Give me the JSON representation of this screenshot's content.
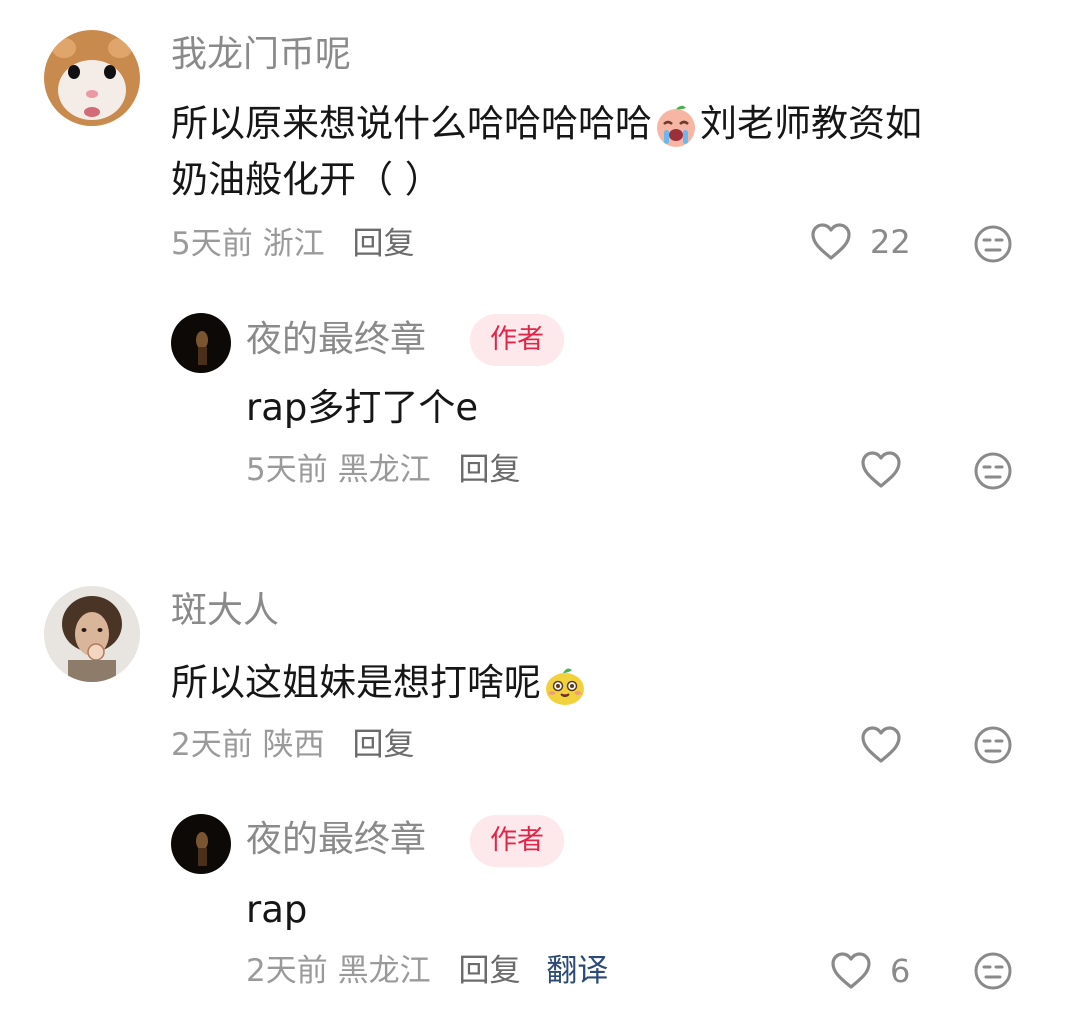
{
  "comments": [
    {
      "username": "我龙门币呢",
      "text_before": "所以原来想说什么哈哈哈哈哈",
      "emoji": "crying-laugh-emoji",
      "text_after": "刘老师教资如",
      "text_line2": "奶油般化开（ ）",
      "time": "5天前",
      "location": "浙江",
      "reply_label": "回复",
      "likes": "22",
      "replies": [
        {
          "username": "夜的最终章",
          "badge": "作者",
          "text": "rap多打了个e",
          "time": "5天前",
          "location": "黑龙江",
          "reply_label": "回复"
        }
      ]
    },
    {
      "username": "斑大人",
      "text": "所以这姐妹是想打啥呢",
      "emoji": "smug-face-emoji",
      "time": "2天前",
      "location": "陕西",
      "reply_label": "回复",
      "replies": [
        {
          "username": "夜的最终章",
          "badge": "作者",
          "text": "rap",
          "time": "2天前",
          "location": "黑龙江",
          "reply_label": "回复",
          "translate_label": "翻译",
          "likes": "6"
        }
      ]
    }
  ],
  "colors": {
    "badge_bg": "#fde8ec",
    "badge_text": "#e0274a",
    "translate": "#2b4a78"
  }
}
